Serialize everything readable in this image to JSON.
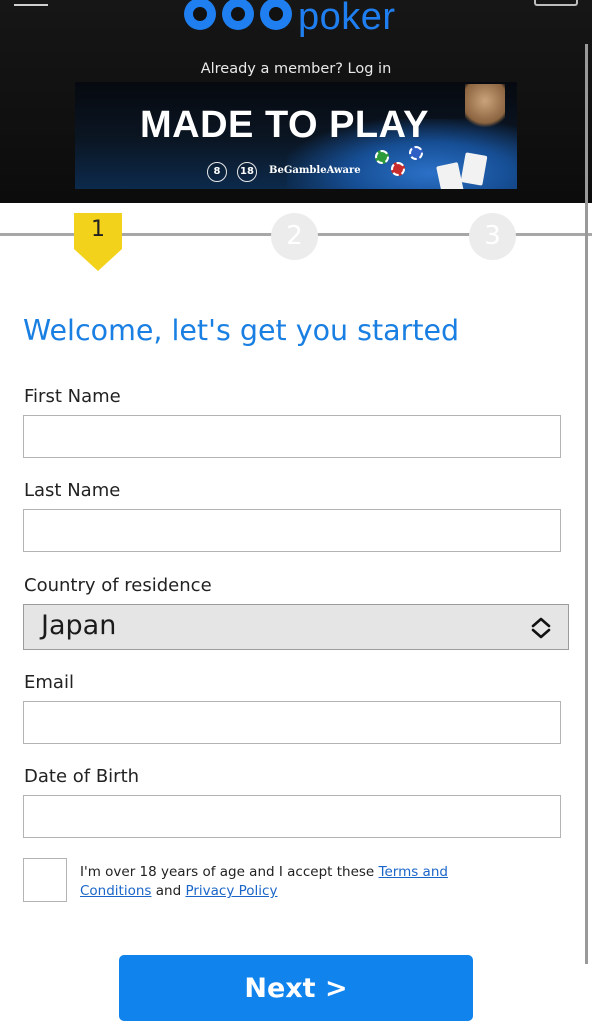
{
  "header": {
    "logo_word": "poker",
    "login_prompt": "Already a member? Log in"
  },
  "banner": {
    "title": "MADE TO PLAY",
    "badge_age_8": "8",
    "badge_age_18": "18",
    "gamble_aware": "BeGambleAware"
  },
  "steps": [
    {
      "number": "1",
      "state": "active"
    },
    {
      "number": "2",
      "state": "inactive"
    },
    {
      "number": "3",
      "state": "inactive"
    }
  ],
  "form": {
    "title": "Welcome, let's get you started",
    "first_name": {
      "label": "First Name",
      "value": ""
    },
    "last_name": {
      "label": "Last Name",
      "value": ""
    },
    "country": {
      "label": "Country of residence",
      "selected": "Japan"
    },
    "email": {
      "label": "Email",
      "value": ""
    },
    "dob": {
      "label": "Date of Birth",
      "value": ""
    },
    "consent": {
      "text_before": "I'm over 18 years of age and I accept these ",
      "terms_link": "Terms and Conditions",
      "text_middle": " and ",
      "privacy_link": "Privacy Policy",
      "checked": false
    },
    "next_label": "Next >"
  },
  "colors": {
    "brand_blue": "#1f7ff0",
    "button_blue": "#1183ec",
    "step_active_yellow": "#f2d21a",
    "header_bg": "#111111"
  },
  "icons": {
    "menu": "menu-icon",
    "select": "chevron-up-down-icon",
    "step_marker": "yellow-pennant-icon"
  }
}
